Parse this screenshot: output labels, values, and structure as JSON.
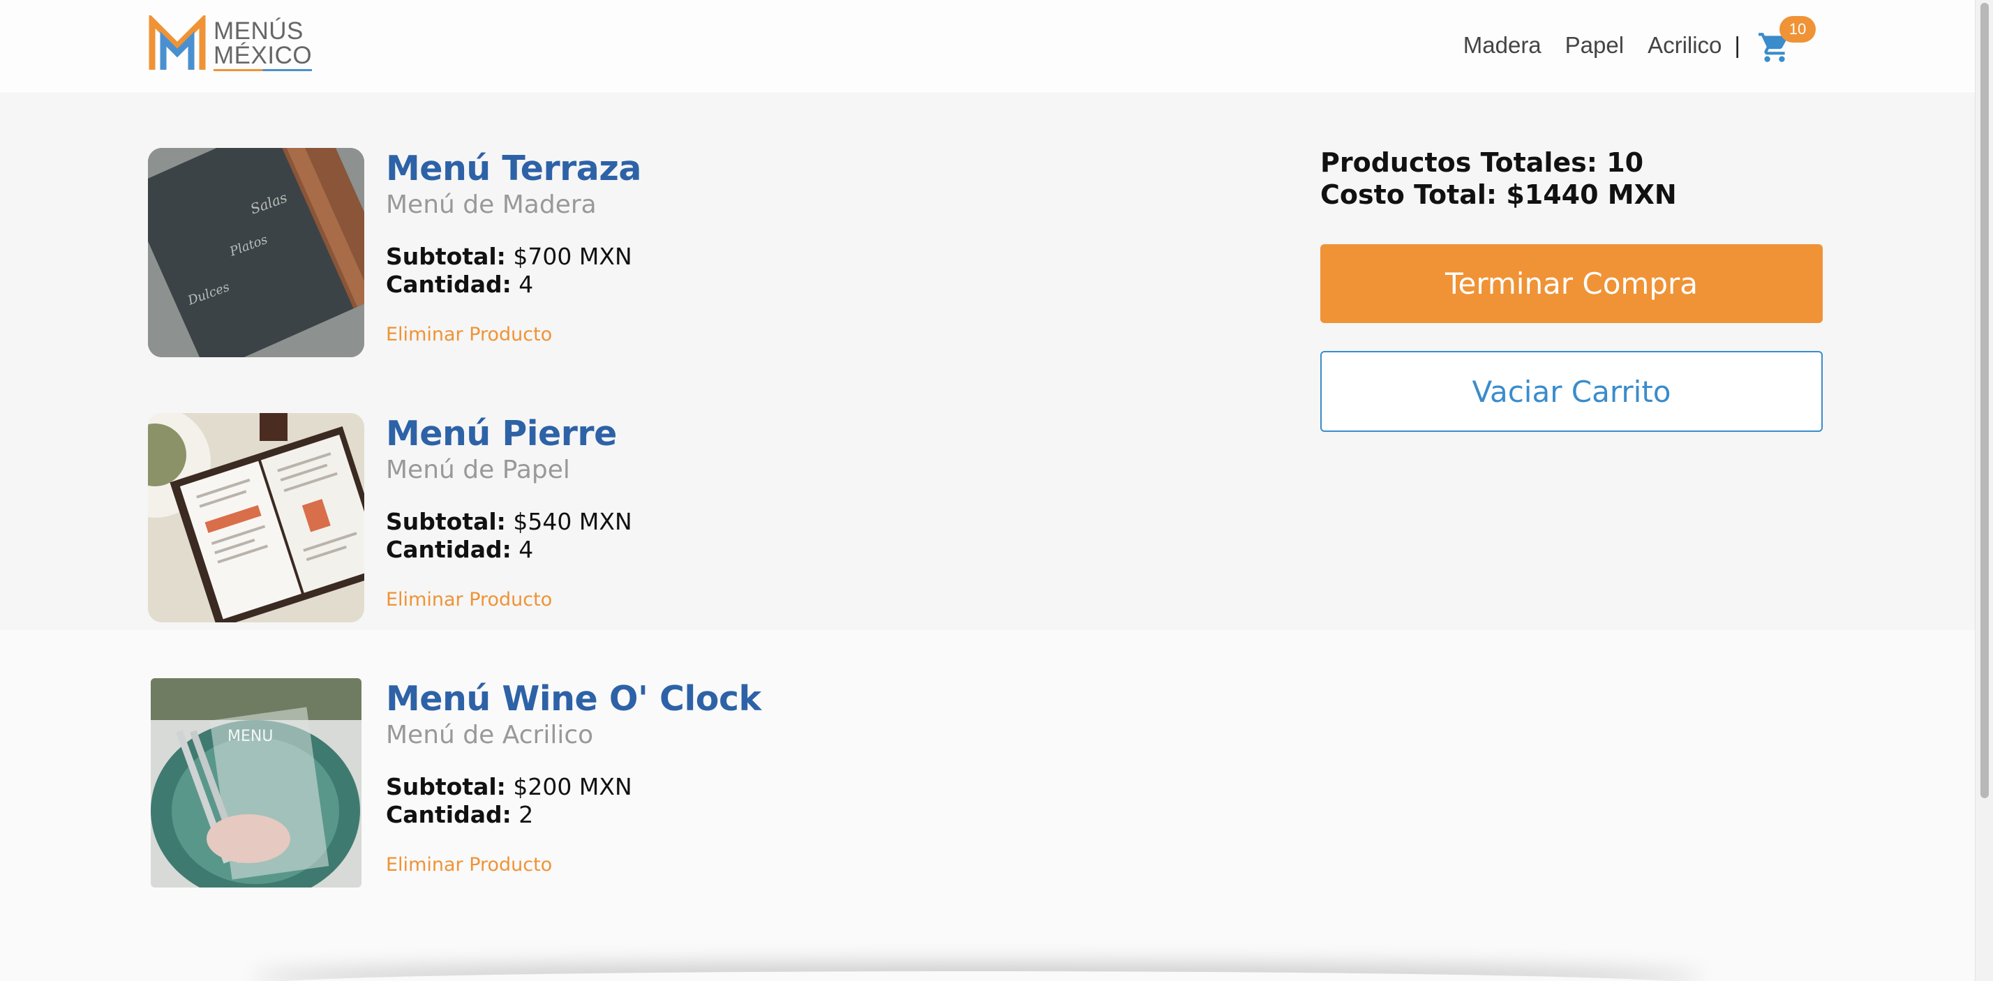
{
  "brand": {
    "line1": "MENÚS",
    "line2": "MÉXICO"
  },
  "nav": {
    "links": [
      "Madera",
      "Papel",
      "Acrilico"
    ],
    "separator": "|",
    "cart_count": "10"
  },
  "cart_items": [
    {
      "name": "Menú Terraza",
      "type": "Menú de Madera",
      "subtotal_label": "Subtotal:",
      "subtotal": "$700 MXN",
      "qty_label": "Cantidad:",
      "qty": "4",
      "remove": "Eliminar Producto"
    },
    {
      "name": "Menú Pierre",
      "type": "Menú de Papel",
      "subtotal_label": "Subtotal:",
      "subtotal": "$540 MXN",
      "qty_label": "Cantidad:",
      "qty": "4",
      "remove": "Eliminar Producto"
    },
    {
      "name": "Menú Wine O' Clock",
      "type": "Menú de Acrilico",
      "subtotal_label": "Subtotal:",
      "subtotal": "$200 MXN",
      "qty_label": "Cantidad:",
      "qty": "2",
      "remove": "Eliminar Producto"
    }
  ],
  "summary": {
    "total_products": "Productos Totales: 10",
    "total_cost": "Costo Total: $1440 MXN",
    "checkout_label": "Terminar Compra",
    "empty_label": "Vaciar Carrito"
  },
  "colors": {
    "accent": "#ef9336",
    "primary": "#2d62a7",
    "link_blue": "#3a8ccb"
  }
}
